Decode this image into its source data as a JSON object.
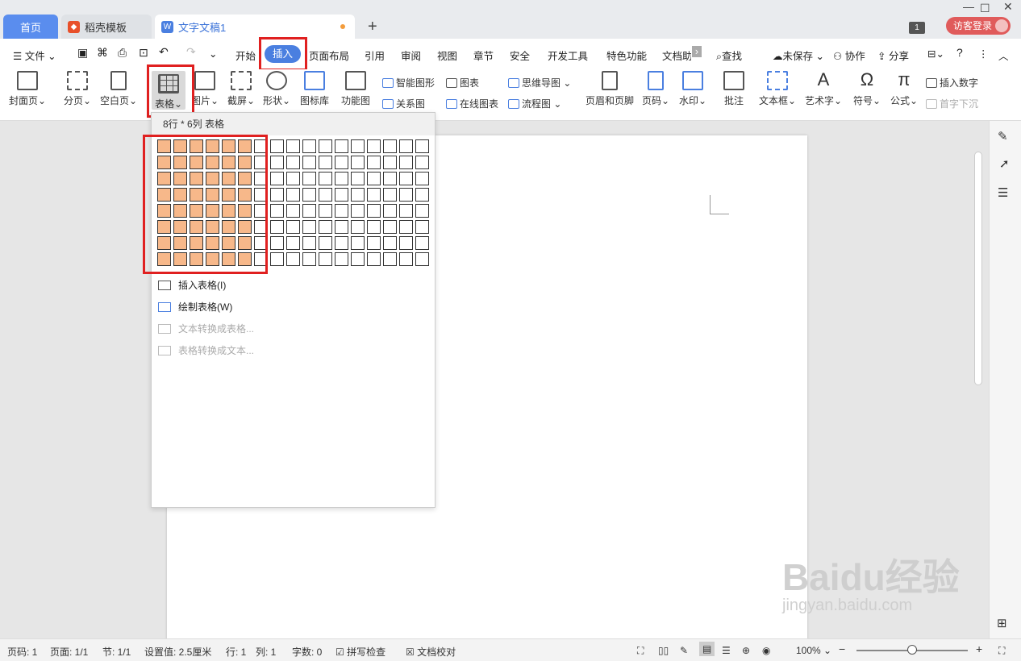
{
  "tabs": {
    "home": "首页",
    "template": "稻壳模板",
    "document": "文字文稿1",
    "new_tab": "+"
  },
  "titlebar": {
    "window_count": "1",
    "login": "访客登录"
  },
  "menu": {
    "file": "文件",
    "items": [
      "开始",
      "插入",
      "页面布局",
      "引用",
      "审阅",
      "视图",
      "章节",
      "安全",
      "开发工具",
      "特色功能",
      "文档助"
    ],
    "active": "插入",
    "search": "查找",
    "unsaved": "未保存",
    "collab": "协作",
    "share": "分享"
  },
  "ribbon": {
    "cover": "封面页",
    "pagebreak": "分页",
    "blank": "空白页",
    "table": "表格",
    "picture": "图片",
    "screenshot": "截屏",
    "shape": "形状",
    "iconlib": "图标库",
    "funcchart": "功能图",
    "smartart": "智能图形",
    "chart": "图表",
    "mindmap": "思维导图",
    "relation": "关系图",
    "onlinechart": "在线图表",
    "flowchart": "流程图",
    "headerfooter": "页眉和页脚",
    "pagenum": "页码",
    "watermark": "水印",
    "comment": "批注",
    "textbox": "文本框",
    "arttext": "艺术字",
    "symbol": "符号",
    "formula": "公式",
    "insertnum": "插入数字",
    "dropcap": "首字下沉"
  },
  "dropdown": {
    "header": "8行 * 6列 表格",
    "grid_rows": 8,
    "grid_cols": 17,
    "selected_rows": 8,
    "selected_cols": 6,
    "items": [
      {
        "label": "插入表格(I)",
        "enabled": true
      },
      {
        "label": "绘制表格(W)",
        "enabled": true
      },
      {
        "label": "文本转换成表格...",
        "enabled": false
      },
      {
        "label": "表格转换成文本...",
        "enabled": false
      }
    ]
  },
  "status": {
    "page": "页码: 1",
    "pages": "页面: 1/1",
    "section": "节: 1/1",
    "setting": "设置值: 2.5厘米",
    "row": "行: 1",
    "col": "列: 1",
    "words": "字数: 0",
    "spell": "拼写检查",
    "proof": "文档校对",
    "zoom": "100%"
  },
  "watermark": {
    "brand": "Baidu经验",
    "url": "jingyan.baidu.com"
  },
  "colors": {
    "accent": "#4a7fe0",
    "grid_selected": "#f7b88a",
    "highlight_box": "#e02020"
  }
}
